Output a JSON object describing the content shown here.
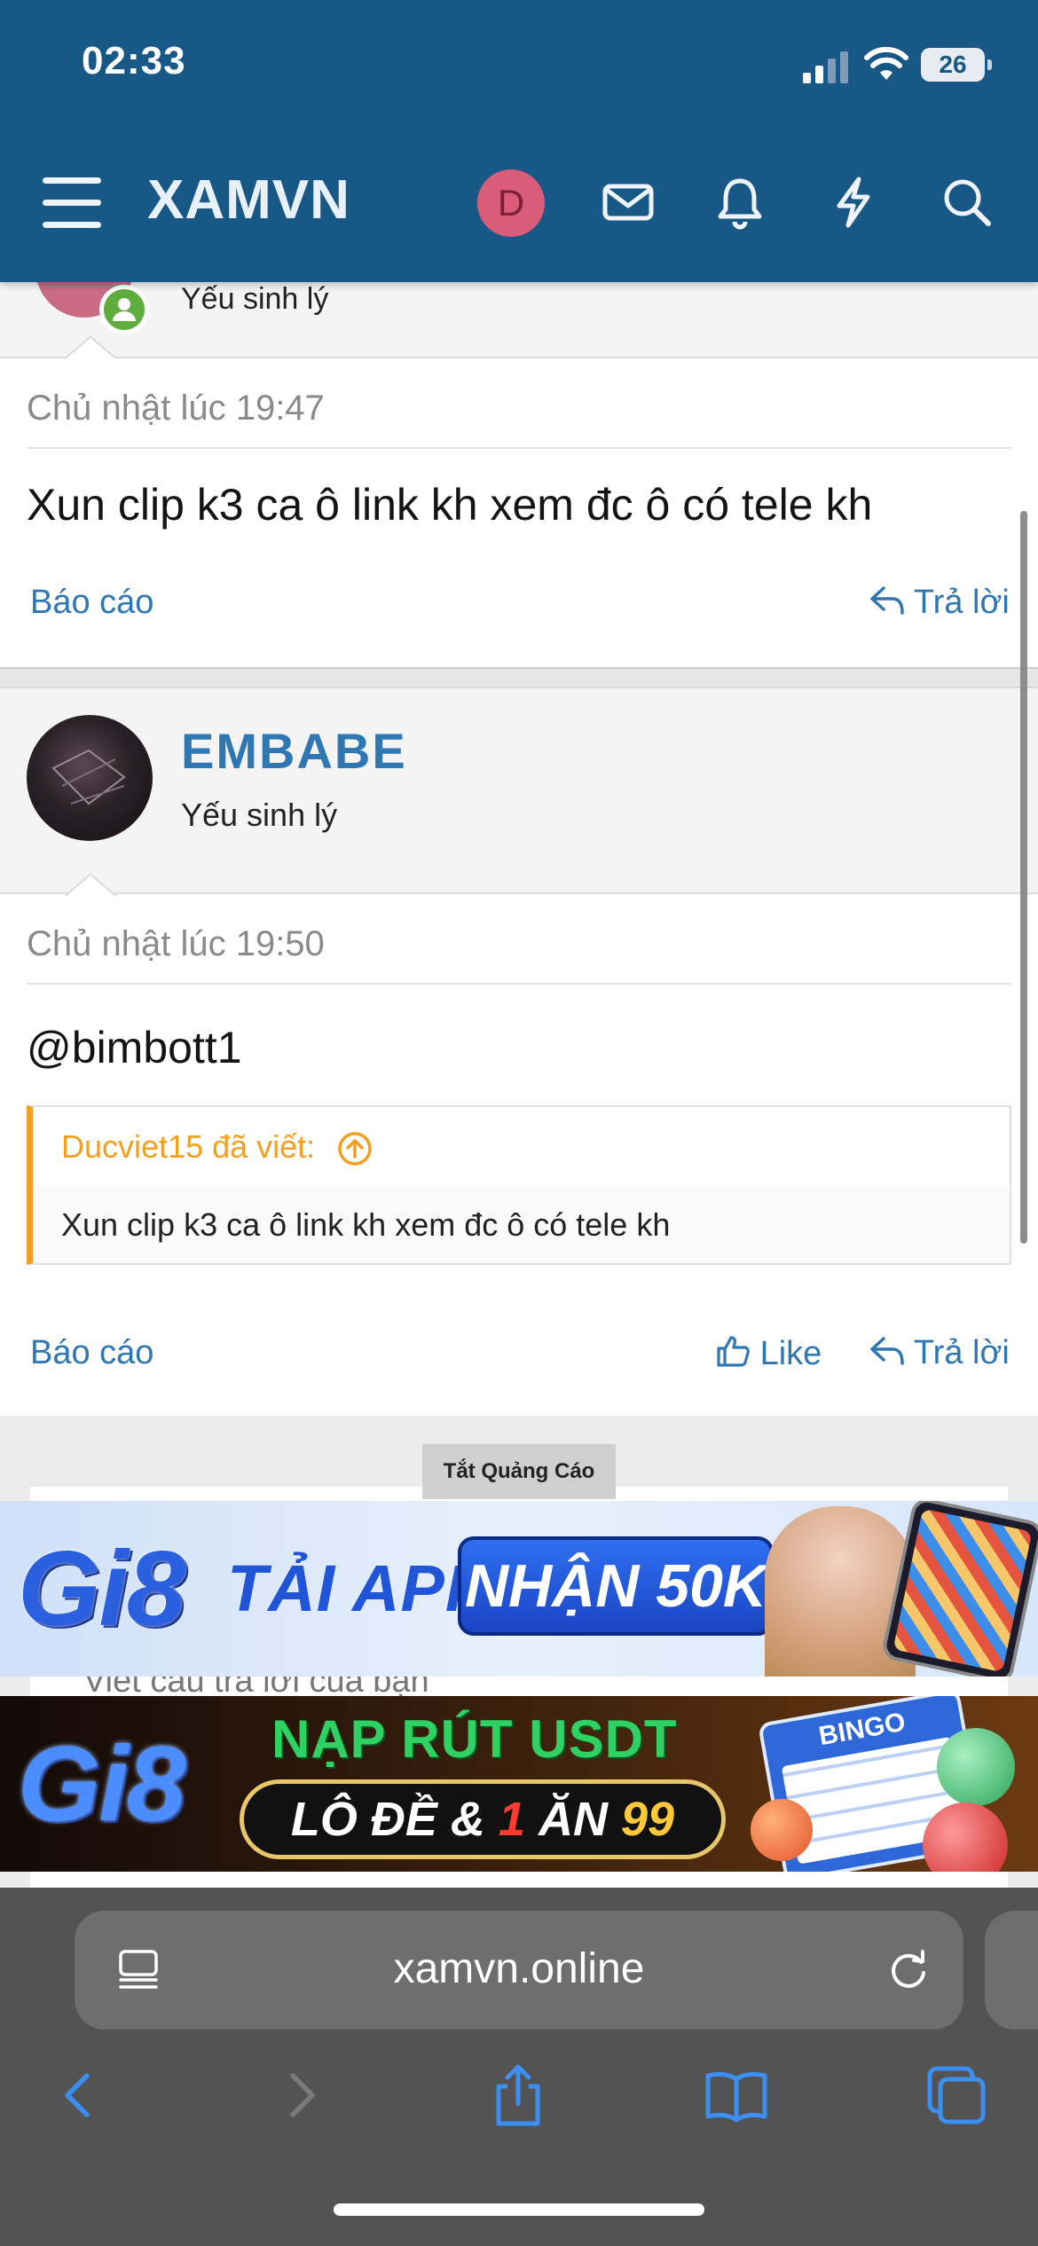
{
  "status_bar": {
    "time": "02:33",
    "battery": "26"
  },
  "header": {
    "logo": "XAMVN",
    "avatar_letter": "D"
  },
  "colors": {
    "header_bg": "#185887",
    "link": "#2f77b3",
    "quote_accent": "#f2a01e",
    "online": "#5fae3d"
  },
  "prev_post": {
    "user_title": "Yếu sinh lý",
    "date": "Chủ nhật lúc 19:47",
    "body": "Xun clip k3 ca ô link kh xem đc ô có tele kh",
    "report_label": "Báo cáo",
    "reply_label": "Trả lời"
  },
  "post": {
    "username": "EMBABE",
    "user_title": "Yếu sinh lý",
    "date": "Chủ nhật lúc 19:50",
    "mention": "@bimbott1",
    "quote": {
      "author": "Ducviet15 đã viết:",
      "text": "Xun clip k3 ca ô link kh xem đc ô có tele kh"
    },
    "report_label": "Báo cáo",
    "like_label": "Like",
    "reply_label": "Trả lời"
  },
  "ads": {
    "label": "Tắt Quảng Cáo",
    "reply_placeholder": "Viết câu trả lời của bạn",
    "banner1": {
      "brand": "Gi8",
      "text1": "TẢI APP",
      "text2": "NHẬN 50K"
    },
    "banner2": {
      "brand": "Gi8",
      "text1": "NẠP RÚT USDT",
      "text2_a": "LÔ ĐỀ & ",
      "text2_b": "1",
      "text2_c": " ĂN ",
      "text2_d": "99",
      "bingo": "BINGO"
    }
  },
  "browser": {
    "url": "xamvn.online"
  }
}
